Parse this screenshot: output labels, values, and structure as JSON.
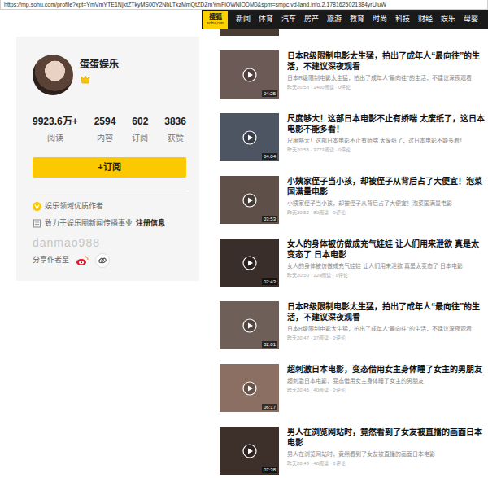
{
  "browser": {
    "url": "https://mp.sohu.com/profile?xpt=YmVmYTE1NjktZTkyMS00Y2NhLTkzMmQtZDZmYmFiOWNlODM0&spm=smpc.vd-land.info.2.1781625021384yrUiuW"
  },
  "header": {
    "logo": {
      "main": "搜狐",
      "sub": "sohu.com"
    },
    "nav": [
      {
        "label": "新闻"
      },
      {
        "label": "体育"
      },
      {
        "label": "汽车"
      },
      {
        "label": "房产"
      },
      {
        "label": "旅游"
      },
      {
        "label": "教育"
      },
      {
        "label": "时尚"
      },
      {
        "label": "科技"
      },
      {
        "label": "财经"
      },
      {
        "label": "娱乐"
      },
      {
        "label": "母婴"
      }
    ]
  },
  "profile": {
    "name": "蛋蛋娱乐",
    "stats": [
      {
        "value": "9923.6万+",
        "label": "阅读"
      },
      {
        "value": "2594",
        "label": "内容"
      },
      {
        "value": "602",
        "label": "订阅"
      },
      {
        "value": "3836",
        "label": "获赞"
      }
    ],
    "subscribe": "+订阅",
    "quality": "娱乐领域优质作者",
    "intro": {
      "text": "致力于娱乐圈新闻传播事业",
      "link": "注册信息"
    },
    "watermark": "danmao988",
    "share": "分享作者至"
  },
  "videos": [
    {
      "title": "日本R级限制电影太生猛，拍出了成年人“最向往”的生活，不建议深夜观看",
      "description": "日本R级限制电影太生猛，拍出了成年人“最向往”的生活，不建议深夜观看",
      "meta": "昨天20:58 · 1400阅读 · 0评论",
      "duration": "04:25"
    },
    {
      "title": "尺度够大！这部日本电影不止有娇喘 太废纸了，这日本电影不能多看！",
      "description": "尺度够大！这部日本电影不止有娇喘 太废纸了，这日本电影不能多看！",
      "meta": "昨天20:55 · 3723阅读 · 0评论",
      "duration": "04:04"
    },
    {
      "title": "小姨家侄子当小孩，却被侄子从背后占了大便宜！泡菜国满量电影",
      "description": "小姨家侄子当小孩，却被侄子从背后占了大便宜！泡菜国满量电影",
      "meta": "昨天20:52 · 80阅读 · 0评论",
      "duration": "03:53"
    },
    {
      "title": "女人的身体被仿做成充气娃娃 让人们用来泄欲 真是太变态了 日本电影",
      "description": "女人的身体被仿做成充气娃娃 让人们用来泄欲 真是太变态了 日本电影",
      "meta": "昨天20:50 · 129阅读 · 0评论",
      "duration": "02:43"
    },
    {
      "title": "日本R级限制电影太生猛，拍出了成年人“最向往”的生活，不建议深夜观看",
      "description": "日本R级限制电影太生猛，拍出了成年人“最向往”的生活，不建议深夜观看",
      "meta": "昨天20:47 · 27阅读 · 0评论",
      "duration": "02:01"
    },
    {
      "title": "超刺激日本电影，变态借用女主身体睡了女主的男朋友",
      "description": "超刺激日本电影，变态借用女主身体睡了女主的男朋友",
      "meta": "昨天20:45 · 40阅读 · 0评论",
      "duration": "06:17"
    },
    {
      "title": "男人在浏览网站时，竟然看到了女友被直播的画面日本电影",
      "description": "男人在浏览网站时，竟然看到了女友被直播的画面日本电影",
      "meta": "昨天20:40 · 40阅读 · 0评论",
      "duration": "07:38"
    }
  ]
}
